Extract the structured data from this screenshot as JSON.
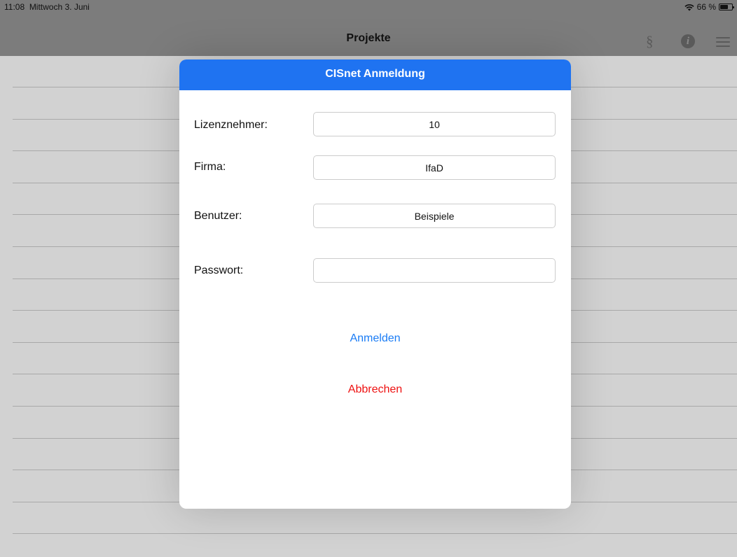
{
  "status_bar": {
    "time": "11:08",
    "date": "Mittwoch 3. Juni",
    "battery": "66 %",
    "battery_level": 0.66
  },
  "nav": {
    "title": "Projekte",
    "icons": [
      "section-icon",
      "info-icon",
      "menu-icon"
    ],
    "section_symbol": "§",
    "info_symbol": "i"
  },
  "dialog": {
    "title": "CISnet Anmeldung",
    "header_color": "#1f73f1",
    "fields": {
      "licensee": {
        "label": "Lizenznehmer:",
        "value": "10"
      },
      "company": {
        "label": "Firma:",
        "value": "IfaD"
      },
      "user": {
        "label": "Benutzer:",
        "value": "Beispiele"
      },
      "password": {
        "label": "Passwort:",
        "value": ""
      }
    },
    "login_label": "Anmelden",
    "cancel_label": "Abbrechen",
    "login_color": "#1a7cf5",
    "cancel_color": "#ee1111"
  }
}
